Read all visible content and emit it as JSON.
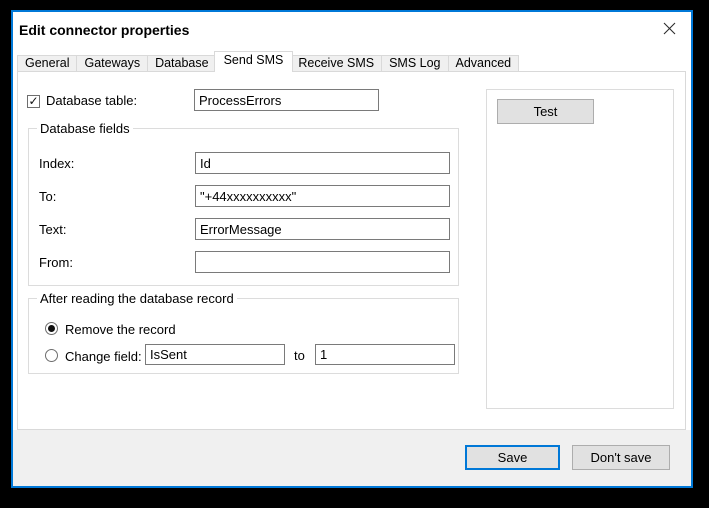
{
  "window": {
    "title": "Edit connector properties"
  },
  "tabs": [
    {
      "label": "General",
      "active": false
    },
    {
      "label": "Gateways",
      "active": false
    },
    {
      "label": "Database",
      "active": false
    },
    {
      "label": "Send SMS",
      "active": true
    },
    {
      "label": "Receive SMS",
      "active": false
    },
    {
      "label": "SMS Log",
      "active": false
    },
    {
      "label": "Advanced",
      "active": false
    }
  ],
  "page": {
    "database_table": {
      "label": "Database table:",
      "checked": true,
      "value": "ProcessErrors"
    },
    "database_fields": {
      "title": "Database fields",
      "rows": [
        {
          "label": "Index:",
          "value": "Id"
        },
        {
          "label": "To:",
          "value": "\"+44xxxxxxxxxx\""
        },
        {
          "label": "Text:",
          "value": "ErrorMessage"
        },
        {
          "label": "From:",
          "value": ""
        }
      ]
    },
    "after_reading": {
      "title": "After reading the database record",
      "options": [
        {
          "label": "Remove the record",
          "selected": true
        },
        {
          "label": "Change field:",
          "selected": false,
          "field_value": "IsSent",
          "to_label": "to",
          "to_value": "1"
        }
      ]
    },
    "test_label": "Test"
  },
  "footer": {
    "save_label": "Save",
    "dont_save_label": "Don't save"
  },
  "icons": {
    "close": "close-icon",
    "check": "✓"
  },
  "colors": {
    "accent_border": "#0078d7",
    "dialog_footer": "#f0f0f0",
    "button_face": "#e1e1e1",
    "groupbox_border": "#dcdcdc",
    "field_border": "#7a7a7a"
  }
}
